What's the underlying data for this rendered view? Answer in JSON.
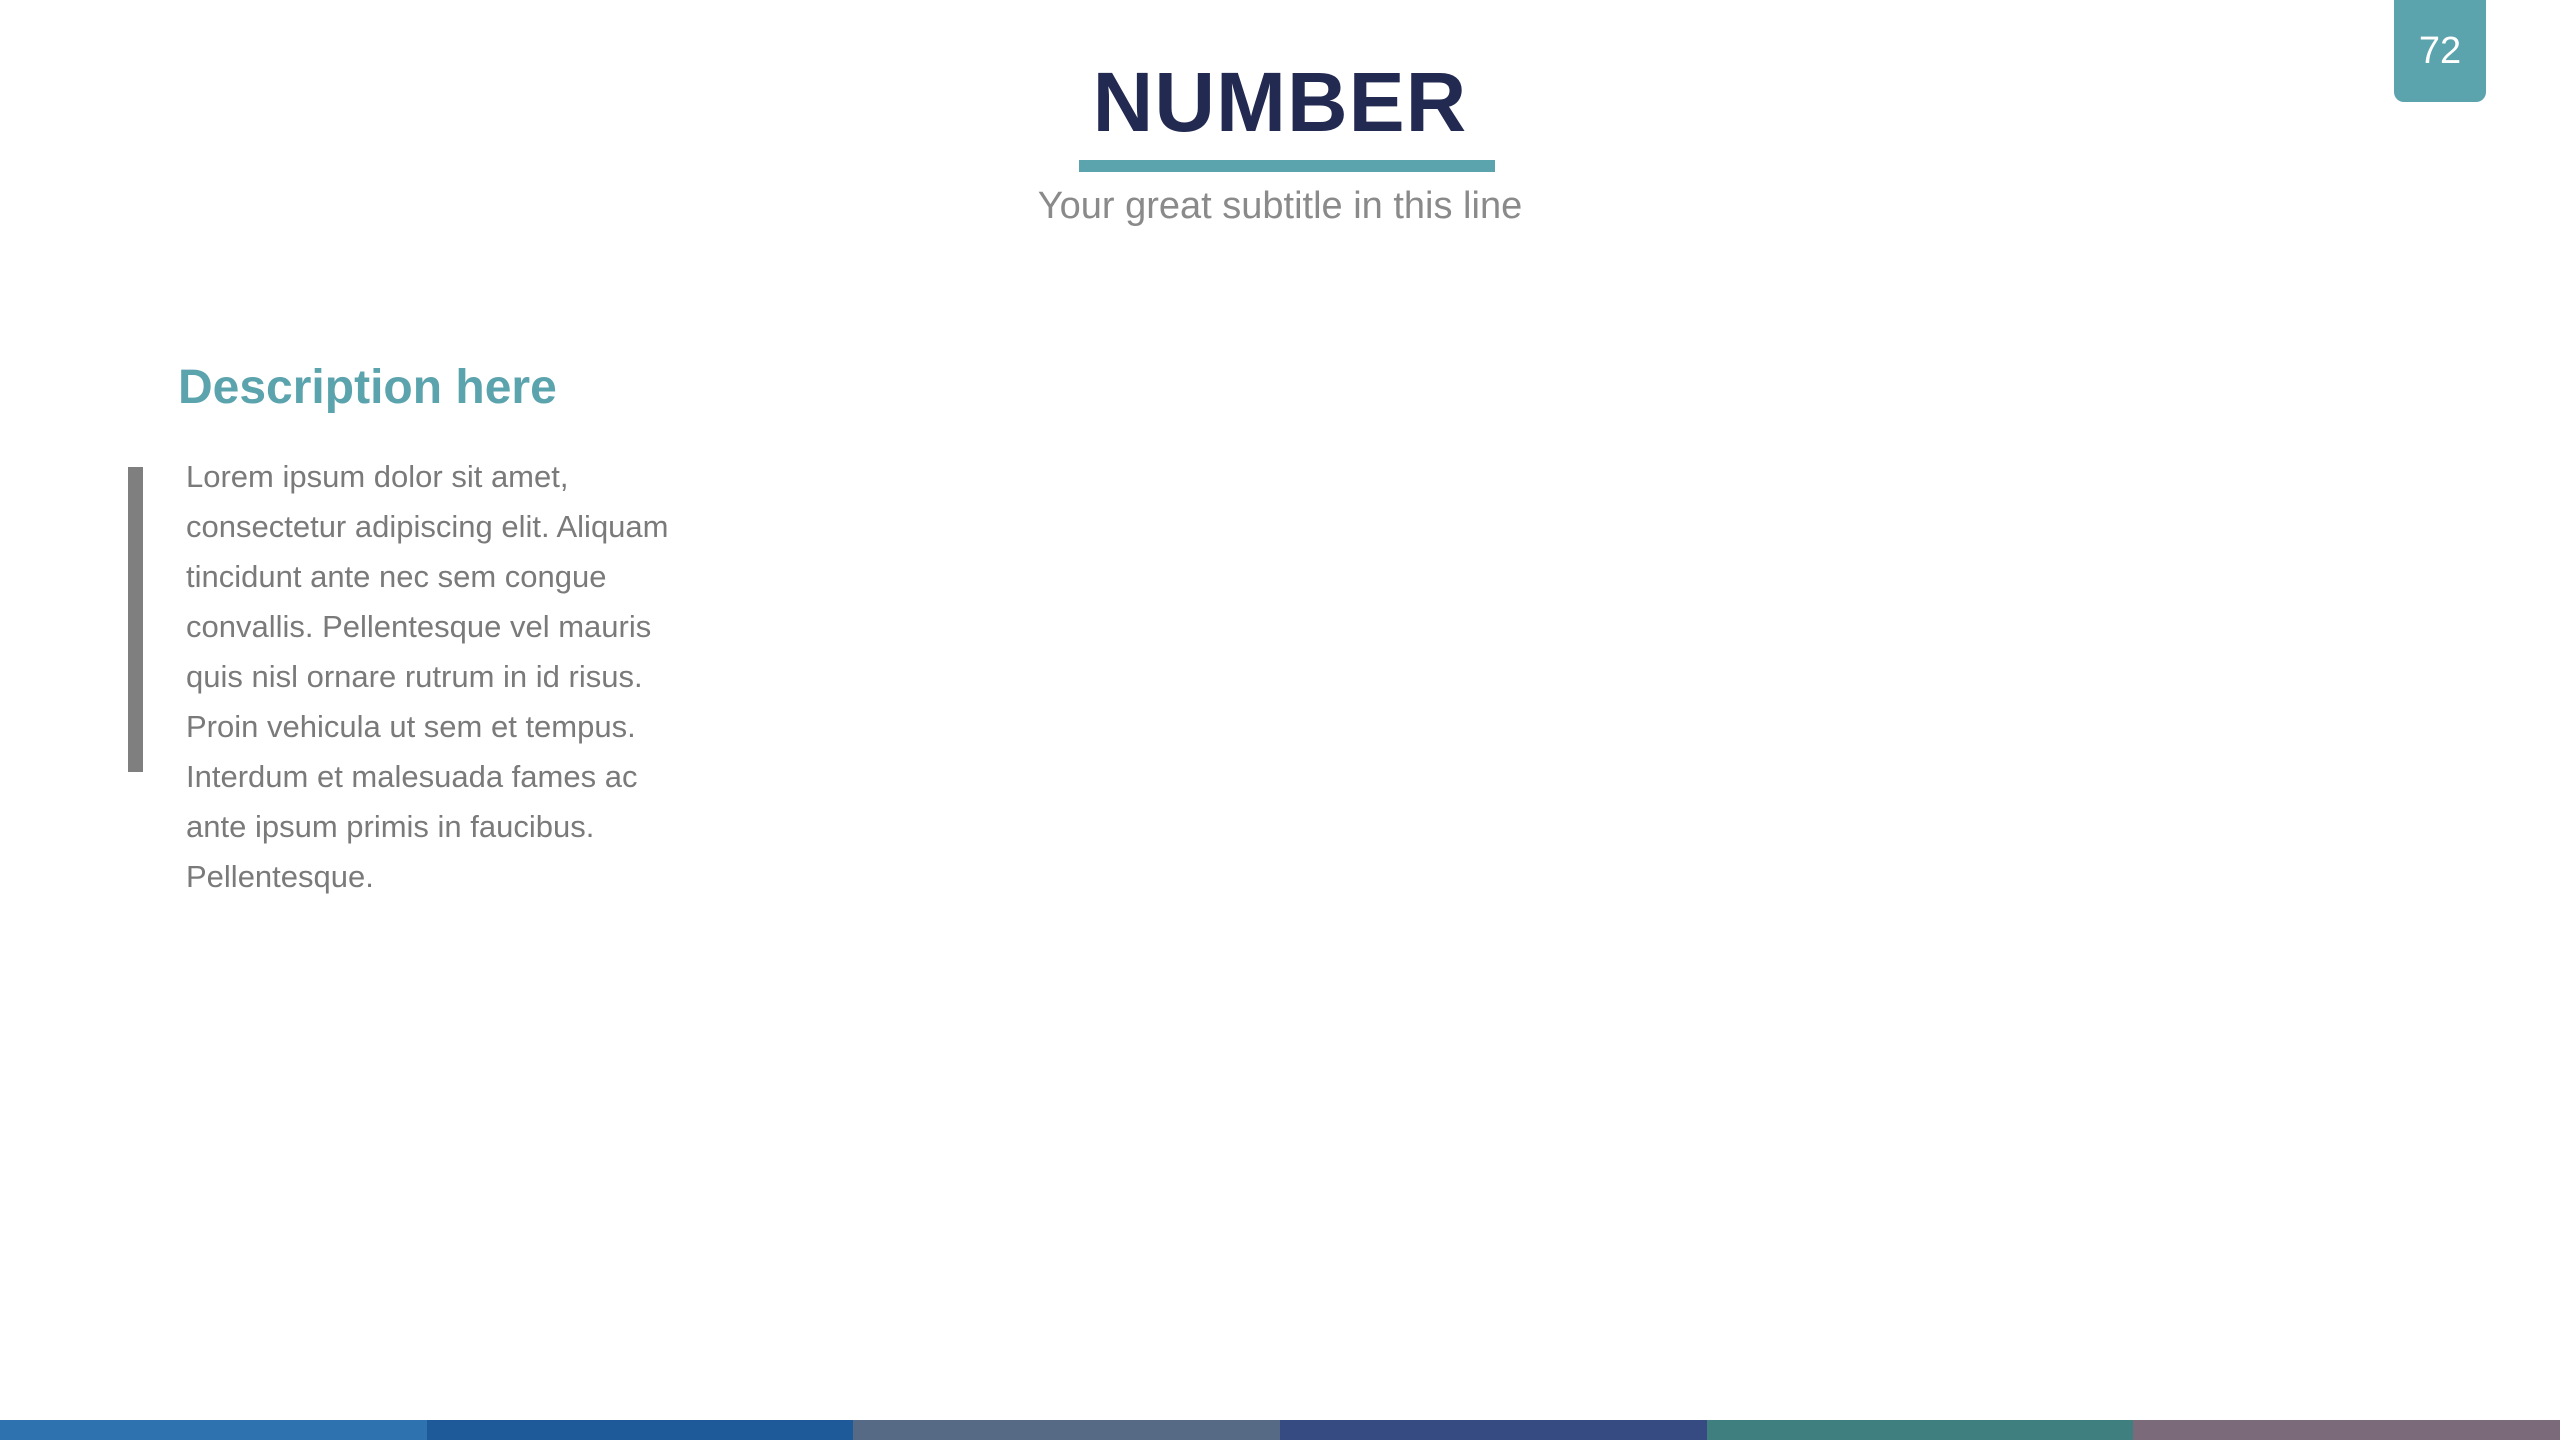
{
  "slide": {
    "page_number": "72",
    "title": "NUMBER",
    "subtitle": "Your great subtitle in this line",
    "description": {
      "heading": "Description here",
      "body": "Lorem ipsum dolor sit amet, consectetur adipiscing elit. Aliquam tincidunt ante nec sem congue convallis. Pellentesque vel mauris quis nisl ornare rutrum in id risus. Proin vehicula ut sem et tempus. Interdum et malesuada fames ac ante ipsum primis in faucibus. Pellentesque."
    }
  },
  "colors": {
    "title": "#232a52",
    "accent": "#5ba3ad",
    "subtitle": "#8a8a8a",
    "body_text": "#7a7a7a",
    "quote_bar": "#7f7f7f",
    "footer_strip": [
      "#2f72b0",
      "#1e5a9a",
      "#566a86",
      "#354b82",
      "#3f7f80",
      "#7a6a7a"
    ]
  }
}
